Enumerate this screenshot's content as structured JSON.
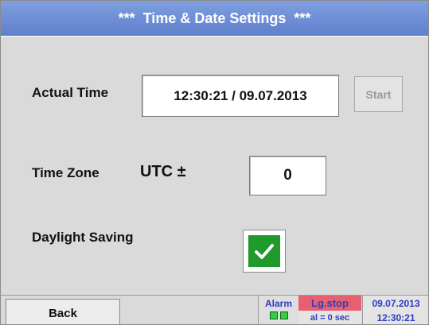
{
  "title": "***  Time & Date Settings  ***",
  "actual_time": {
    "label": "Actual Time",
    "value": "12:30:21 / 09.07.2013",
    "start_label": "Start"
  },
  "time_zone": {
    "label": "Time Zone",
    "utc_label": "UTC ±",
    "value": "0"
  },
  "daylight_saving": {
    "label": "Daylight Saving",
    "checked": true
  },
  "footer": {
    "back_label": "Back",
    "alarm_label": "Alarm",
    "logger_status": "Lg.stop",
    "logger_interval": "al = 0 sec",
    "date": "09.07.2013",
    "time": "12:30:21"
  },
  "colors": {
    "title_bar": "#6f8fd6",
    "background": "#dadada",
    "check_green": "#1f9a2b",
    "status_red": "#e85f6f",
    "status_text": "#2b3fbf"
  }
}
